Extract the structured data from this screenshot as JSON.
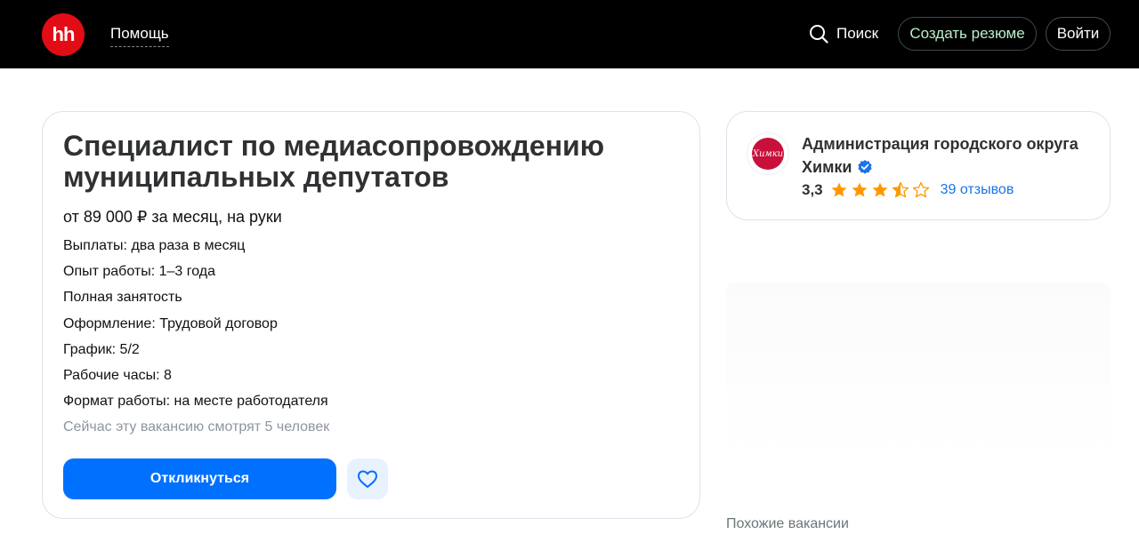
{
  "header": {
    "logo_text": "hh",
    "help_label": "Помощь",
    "search_label": "Поиск",
    "create_resume_label": "Создать резюме",
    "login_label": "Войти"
  },
  "vacancy": {
    "title": "Специалист по медиасопровождению муниципальных депутатов",
    "salary": "от 89 000 ₽ за месяц, на руки",
    "details": [
      "Выплаты: два раза в месяц",
      "Опыт работы: 1–3 года",
      "Полная занятость",
      "Оформление: Трудовой договор",
      "График: 5/2",
      "Рабочие часы: 8",
      "Формат работы: на месте работодателя"
    ],
    "viewers": "Сейчас эту вакансию смотрят 5 человек",
    "apply_label": "Откликнуться"
  },
  "employer": {
    "logo_text": "Химки",
    "name": "Администрация городского округа Химки",
    "rating": "3,3",
    "stars_rating": 3.3,
    "reviews": "39 отзывов"
  },
  "similar_label": "Похожие вакансии",
  "colors": {
    "brand_red": "#e20c16",
    "primary_blue": "#0070ff",
    "star_orange": "#ff9900",
    "link_blue": "#1a73e8"
  }
}
